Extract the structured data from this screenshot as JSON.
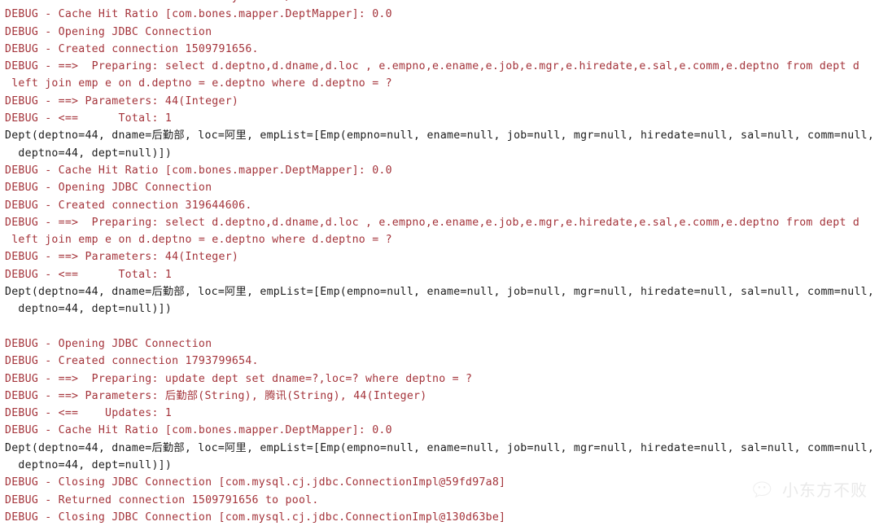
{
  "console": {
    "background_color": "#ffffff",
    "debug_text_color": "#a4333a",
    "stdout_text_color": "#1c1c1c",
    "lines": [
      {
        "kind": "debug",
        "text": "DEBUG - PooledDataSource forcefully closed/removed all connections."
      },
      {
        "kind": "debug",
        "text": "DEBUG - Cache Hit Ratio [com.bones.mapper.DeptMapper]: 0.0"
      },
      {
        "kind": "debug",
        "text": "DEBUG - Opening JDBC Connection"
      },
      {
        "kind": "debug",
        "text": "DEBUG - Created connection 1509791656."
      },
      {
        "kind": "debug",
        "text": "DEBUG - ==>  Preparing: select d.deptno,d.dname,d.loc , e.empno,e.ename,e.job,e.mgr,e.hiredate,e.sal,e.comm,e.deptno from dept d"
      },
      {
        "kind": "debug-cont",
        "text": " left join emp e on d.deptno = e.deptno where d.deptno = ?"
      },
      {
        "kind": "debug",
        "text": "DEBUG - ==> Parameters: 44(Integer)"
      },
      {
        "kind": "debug",
        "text": "DEBUG - <==      Total: 1"
      },
      {
        "kind": "stdout",
        "text": "Dept(deptno=44, dname=后勤部, loc=阿里, empList=[Emp(empno=null, ename=null, job=null, mgr=null, hiredate=null, sal=null, comm=null,"
      },
      {
        "kind": "stdout-cont",
        "text": "  deptno=44, dept=null)])"
      },
      {
        "kind": "debug",
        "text": "DEBUG - Cache Hit Ratio [com.bones.mapper.DeptMapper]: 0.0"
      },
      {
        "kind": "debug",
        "text": "DEBUG - Opening JDBC Connection"
      },
      {
        "kind": "debug",
        "text": "DEBUG - Created connection 319644606."
      },
      {
        "kind": "debug",
        "text": "DEBUG - ==>  Preparing: select d.deptno,d.dname,d.loc , e.empno,e.ename,e.job,e.mgr,e.hiredate,e.sal,e.comm,e.deptno from dept d"
      },
      {
        "kind": "debug-cont",
        "text": " left join emp e on d.deptno = e.deptno where d.deptno = ?"
      },
      {
        "kind": "debug",
        "text": "DEBUG - ==> Parameters: 44(Integer)"
      },
      {
        "kind": "debug",
        "text": "DEBUG - <==      Total: 1"
      },
      {
        "kind": "stdout",
        "text": "Dept(deptno=44, dname=后勤部, loc=阿里, empList=[Emp(empno=null, ename=null, job=null, mgr=null, hiredate=null, sal=null, comm=null,"
      },
      {
        "kind": "stdout-cont",
        "text": "  deptno=44, dept=null)])"
      },
      {
        "kind": "blank",
        "text": " "
      },
      {
        "kind": "debug",
        "text": "DEBUG - Opening JDBC Connection"
      },
      {
        "kind": "debug",
        "text": "DEBUG - Created connection 1793799654."
      },
      {
        "kind": "debug",
        "text": "DEBUG - ==>  Preparing: update dept set dname=?,loc=? where deptno = ?"
      },
      {
        "kind": "debug",
        "text": "DEBUG - ==> Parameters: 后勤部(String), 腾讯(String), 44(Integer)"
      },
      {
        "kind": "debug",
        "text": "DEBUG - <==    Updates: 1"
      },
      {
        "kind": "debug",
        "text": "DEBUG - Cache Hit Ratio [com.bones.mapper.DeptMapper]: 0.0"
      },
      {
        "kind": "stdout",
        "text": "Dept(deptno=44, dname=后勤部, loc=阿里, empList=[Emp(empno=null, ename=null, job=null, mgr=null, hiredate=null, sal=null, comm=null,"
      },
      {
        "kind": "stdout-cont",
        "text": "  deptno=44, dept=null)])"
      },
      {
        "kind": "debug",
        "text": "DEBUG - Closing JDBC Connection [com.mysql.cj.jdbc.ConnectionImpl@59fd97a8]"
      },
      {
        "kind": "debug",
        "text": "DEBUG - Returned connection 1509791656 to pool."
      },
      {
        "kind": "debug",
        "text": "DEBUG - Closing JDBC Connection [com.mysql.cj.jdbc.ConnectionImpl@130d63be]"
      }
    ]
  },
  "watermark": {
    "text": "小东方不败",
    "icon": "wechat-logo-icon",
    "color": "#b9b9b9"
  }
}
